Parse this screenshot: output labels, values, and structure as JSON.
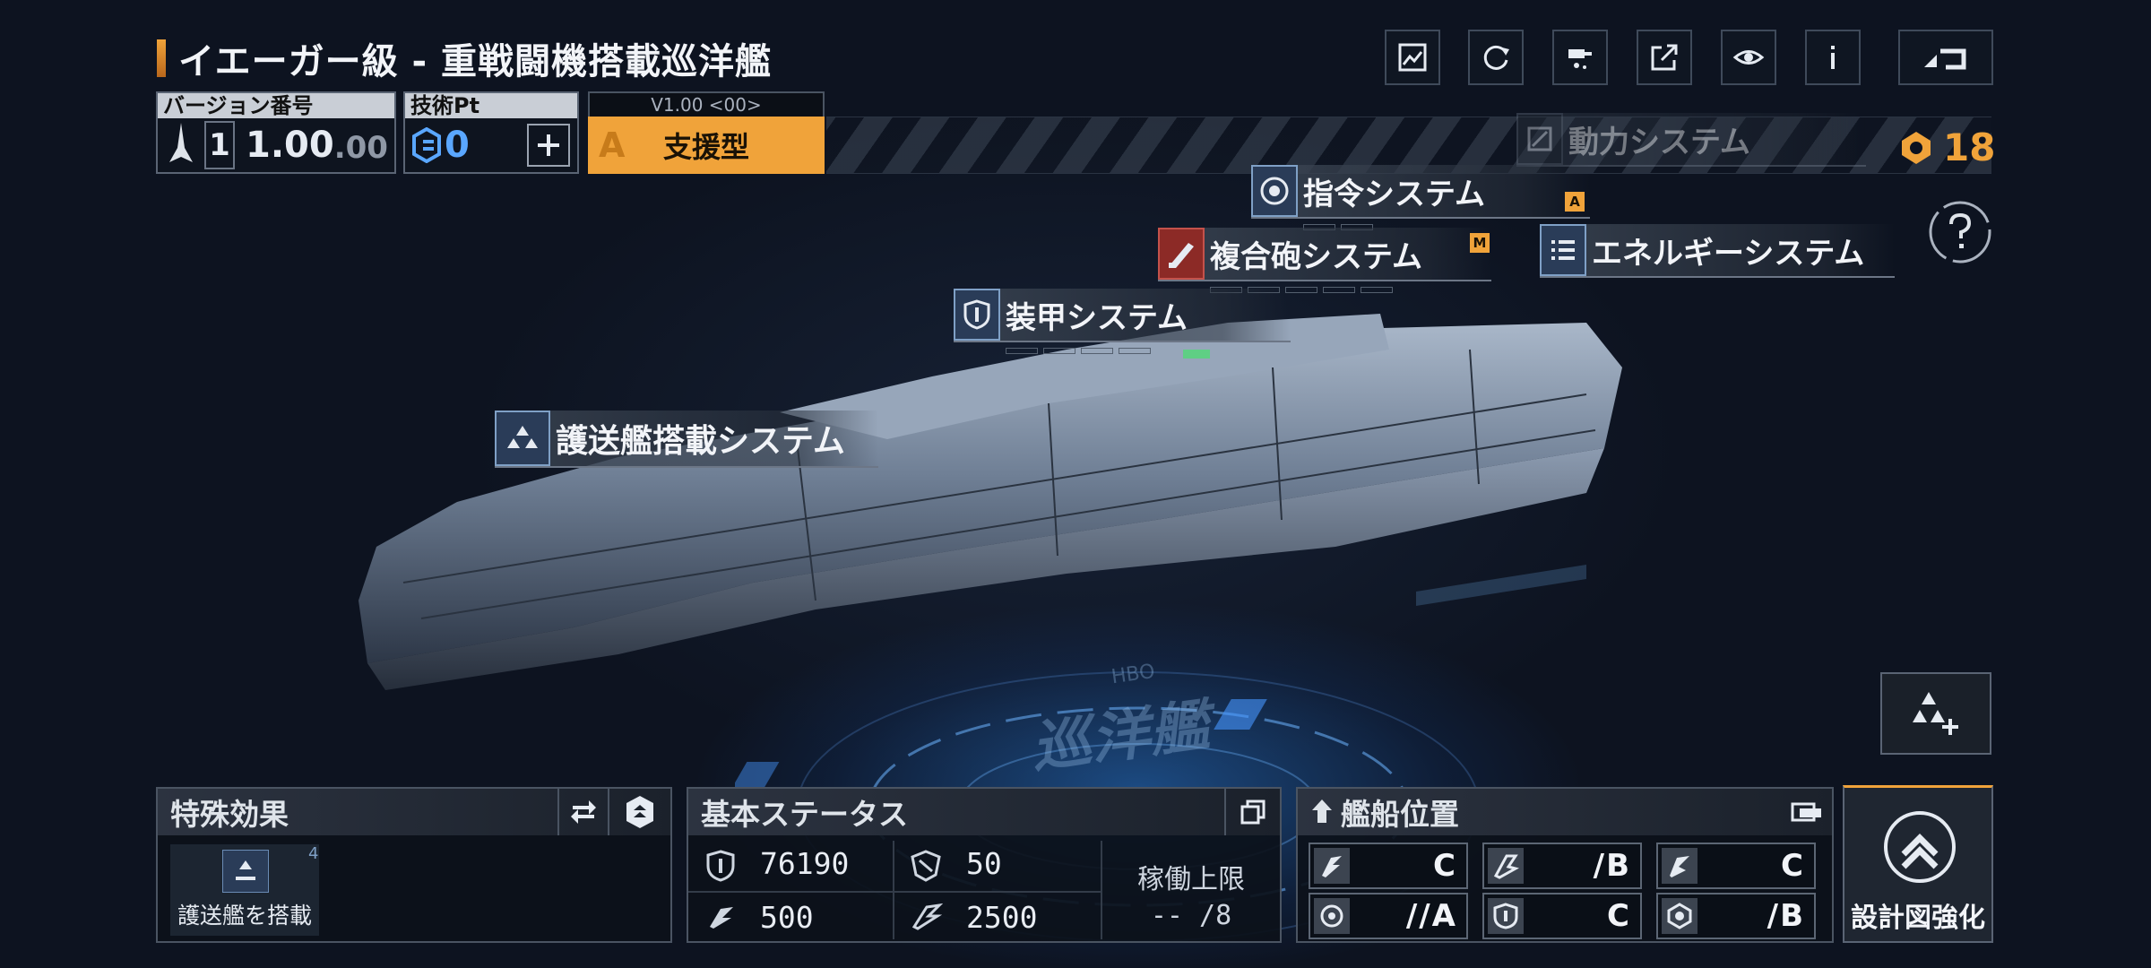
{
  "ship": {
    "title": "イエーガー級 - 重戦闘機搭載巡洋艦"
  },
  "version": {
    "label": "バージョン番号",
    "tier": "1",
    "number": "1.00",
    "sub": ".00"
  },
  "tech": {
    "label": "技術Pt",
    "points": "0"
  },
  "build": {
    "version_tag": "V1.00 <00>",
    "rank": "A",
    "type": "支援型"
  },
  "currency": {
    "amount": "18"
  },
  "systems": {
    "power": "動力システム",
    "command": "指令システム",
    "command_badge": "A",
    "cannon": "複合砲システム",
    "cannon_badge": "M",
    "energy": "エネルギーシステム",
    "armor": "装甲システム",
    "escort": "護送艦搭載システム"
  },
  "floor_text": "巡洋艦",
  "floor_small": "HBO",
  "special": {
    "title": "特殊効果",
    "item_label": "護送艦を搭載",
    "item_count": "4"
  },
  "base_status": {
    "title": "基本ステータス",
    "hp": "76190",
    "armor": "50",
    "speed": "500",
    "range": "2500",
    "limit_label": "稼働上限",
    "limit_value": "-- /8"
  },
  "position": {
    "title": "艦船位置",
    "grades": [
      "C",
      "/B",
      "C",
      "//A",
      "C",
      "/B"
    ]
  },
  "upgrade": {
    "label": "設計図強化"
  },
  "colors": {
    "accent": "#f0a33a",
    "panel_border": "#4a5462",
    "sys_blue": "#2a3c58",
    "sys_red": "#8c2a26"
  },
  "icons": [
    "screenshot-icon",
    "refresh-icon",
    "paint-icon",
    "share-icon",
    "view-icon",
    "info-icon",
    "back-icon",
    "help-icon",
    "fleet-add-icon"
  ]
}
